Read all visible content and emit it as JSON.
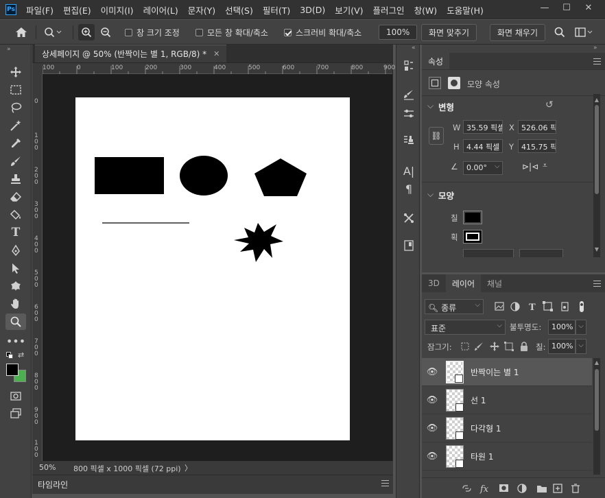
{
  "app": {
    "logo": "Ps"
  },
  "menu": [
    "파일(F)",
    "편집(E)",
    "이미지(I)",
    "레이어(L)",
    "문자(Y)",
    "선택(S)",
    "필터(T)",
    "3D(D)",
    "보기(V)",
    "플러그인",
    "창(W)",
    "도움말(H)"
  ],
  "window_controls": {
    "minimize": "—",
    "restore": "☐",
    "close": "✕"
  },
  "options": {
    "resize_windows": "창 크기 조정",
    "zoom_all_windows": "모든 창 확대/축소",
    "scrubby_zoom": "스크러비 확대/축소",
    "zoom_percent": "100%",
    "fit_screen": "화면 맞추기",
    "fill_screen": "화면 채우기"
  },
  "document": {
    "tab_title": "상세페이지 @ 50% (반짝이는 별 1, RGB/8) *",
    "zoom": "50%",
    "doc_size": "800 픽셀 x 1000 픽셀 (72 ppi)",
    "status_arrow": "〉"
  },
  "ruler": {
    "h_labels": [
      "100",
      "0",
      "100",
      "200",
      "300",
      "400",
      "500",
      "600",
      "700",
      "800",
      "900"
    ],
    "v_labels": [
      "0",
      "1 0 0",
      "2 0 0",
      "3 0 0",
      "4 0 0",
      "5 0 0",
      "6 0 0",
      "7 0 0",
      "8 0 0",
      "9 0 0",
      "1 0 0"
    ]
  },
  "timeline": {
    "label": "타임라인"
  },
  "properties": {
    "tab": "속성",
    "shape_props": "모양 속성",
    "transform_header": "변형",
    "w_label": "W",
    "w_value": "35.59 픽셀",
    "h_label": "H",
    "h_value": "4.44 픽셀",
    "x_label": "X",
    "x_value": "526.06 픽",
    "y_label": "Y",
    "y_value": "415.75 픽",
    "angle_value": "0.00°",
    "shape_header": "모양",
    "fill_label": "칠",
    "stroke_label": "획",
    "fill_color": "#000000"
  },
  "layers_panel": {
    "tabs": [
      "3D",
      "레이어",
      "채널"
    ],
    "filter_kind": "종류",
    "blend_mode": "표준",
    "opacity_label": "불투명도:",
    "opacity_value": "100%",
    "lock_label": "잠그기:",
    "fill_label": "칠:",
    "fill_value": "100%",
    "layers": [
      {
        "name": "반짝이는 별 1",
        "selected": true
      },
      {
        "name": "선 1",
        "selected": false
      },
      {
        "name": "다각형 1",
        "selected": false
      },
      {
        "name": "타원 1",
        "selected": false
      }
    ]
  },
  "colors": {
    "foreground": "#000000",
    "background": "#4caf50",
    "accent": "#31a8ff"
  }
}
